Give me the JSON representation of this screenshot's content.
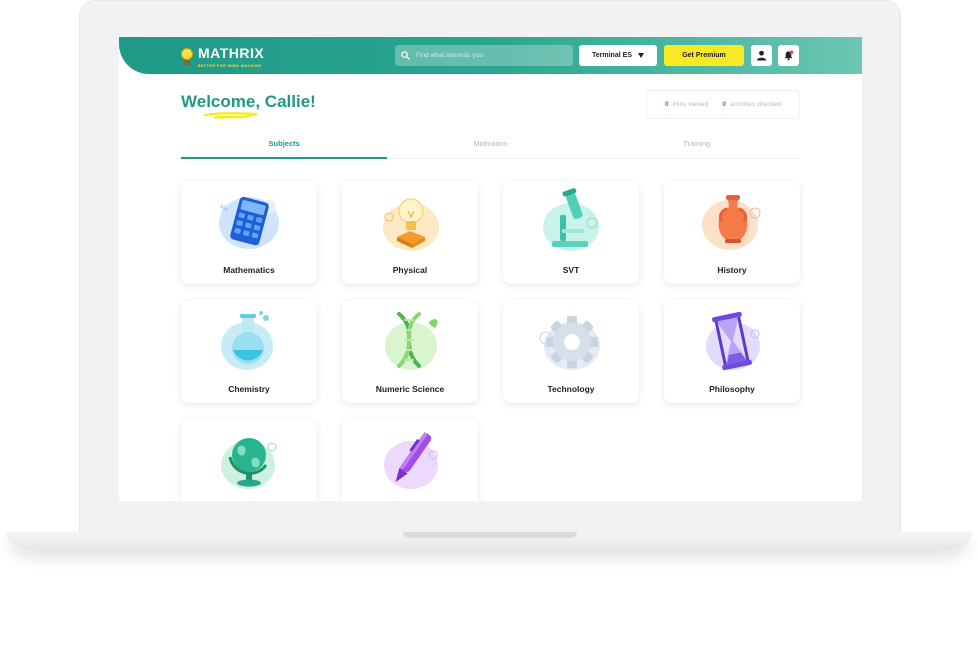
{
  "header": {
    "logo_text": "MATHRIX",
    "logo_tagline": "BETTER FOR MIND MACHINE",
    "search_placeholder": "Find what interests you",
    "level_select": "Terminal ES",
    "premium_label": "Get Premium",
    "colors": {
      "accent": "#1f9a86",
      "premium": "#f6e925"
    }
  },
  "welcome": {
    "greeting": "Welcome,",
    "name": "Callie!"
  },
  "stats": {
    "mins_value": "0",
    "mins_label": "mins viewed",
    "activities_value": "0",
    "activities_label": "activities checked"
  },
  "tabs": [
    {
      "label": "Subjects",
      "active": true
    },
    {
      "label": "Motivation",
      "active": false
    },
    {
      "label": "Training",
      "active": false
    }
  ],
  "subjects": [
    {
      "label": "Mathematics",
      "icon": "calculator-icon"
    },
    {
      "label": "Physical",
      "icon": "lightbulb-icon"
    },
    {
      "label": "SVT",
      "icon": "microscope-icon"
    },
    {
      "label": "History",
      "icon": "amphora-icon"
    },
    {
      "label": "Chemistry",
      "icon": "flask-icon"
    },
    {
      "label": "Numeric Science",
      "icon": "dna-icon"
    },
    {
      "label": "Technology",
      "icon": "gear-icon"
    },
    {
      "label": "Philosophy",
      "icon": "hourglass-icon"
    },
    {
      "label": "",
      "icon": "globe-icon"
    },
    {
      "label": "",
      "icon": "pen-icon"
    }
  ]
}
